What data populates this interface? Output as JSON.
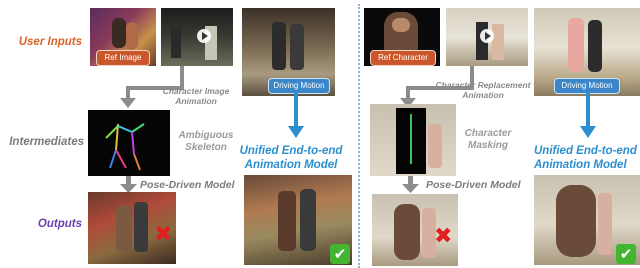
{
  "row_labels": {
    "inputs": "User Inputs",
    "intermediates": "Intermediates",
    "outputs": "Outputs"
  },
  "left_panel": {
    "ref_button": "Ref Image",
    "driving_button": "Driving Motion",
    "task_label_1": "Character Image",
    "task_label_2": "Animation",
    "intermediate_label_1": "Ambiguous",
    "intermediate_label_2": "Skeleton",
    "pose_model": "Pose-Driven Model",
    "unified_line1": "Unified End-to-end",
    "unified_line2": "Animation Model"
  },
  "right_panel": {
    "ref_button": "Ref Character",
    "driving_button": "Driving Motion",
    "task_label_1": "Character Replacement",
    "task_label_2": "Animation",
    "intermediate_label_1": "Character",
    "intermediate_label_2": "Masking",
    "pose_model": "Pose-Driven Model",
    "unified_line1": "Unified End-to-end",
    "unified_line2": "Animation Model"
  },
  "colors": {
    "inputs_label": "#d9642a",
    "intermediates_label": "#7a7a7a",
    "outputs_label": "#6a3fb0",
    "blue_arrow": "#2b8fd0",
    "gray_arrow": "#8c8c8c",
    "divider": "#8db3d6"
  },
  "icons": {
    "fail": "red-x-icon",
    "success": "green-check-icon",
    "play": "play-icon"
  }
}
